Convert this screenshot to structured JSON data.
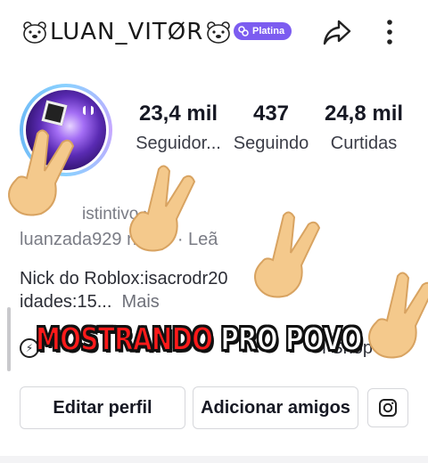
{
  "header": {
    "username": "LUAN_VITØR",
    "badge": "Platina"
  },
  "profile": {
    "stats": [
      {
        "value": "23,4 mil",
        "label": "Seguidor..."
      },
      {
        "value": "437",
        "label": "Seguindo"
      },
      {
        "value": "24,8 mil",
        "label": "Curtidas"
      }
    ],
    "distintivo": "istintivo ›",
    "meta_line": "luanzada929        nhero · Leã",
    "bio_line1": "Nick do Roblox:isacrodr20",
    "bio_line2": "idades:15...",
    "more_label": "Mais",
    "shop_label": "i Shop"
  },
  "overlay": {
    "part1": "MOSTRANDO",
    "part2": "PRO POVO"
  },
  "buttons": {
    "edit": "Editar perfil",
    "add_friends": "Adicionar amigos"
  },
  "icons": {
    "share": "share-arrow-icon",
    "more": "more-vertical-icon",
    "instagram": "instagram-icon",
    "bear": "polar-bear-emoji",
    "hand": "victory-hand-emoji"
  }
}
